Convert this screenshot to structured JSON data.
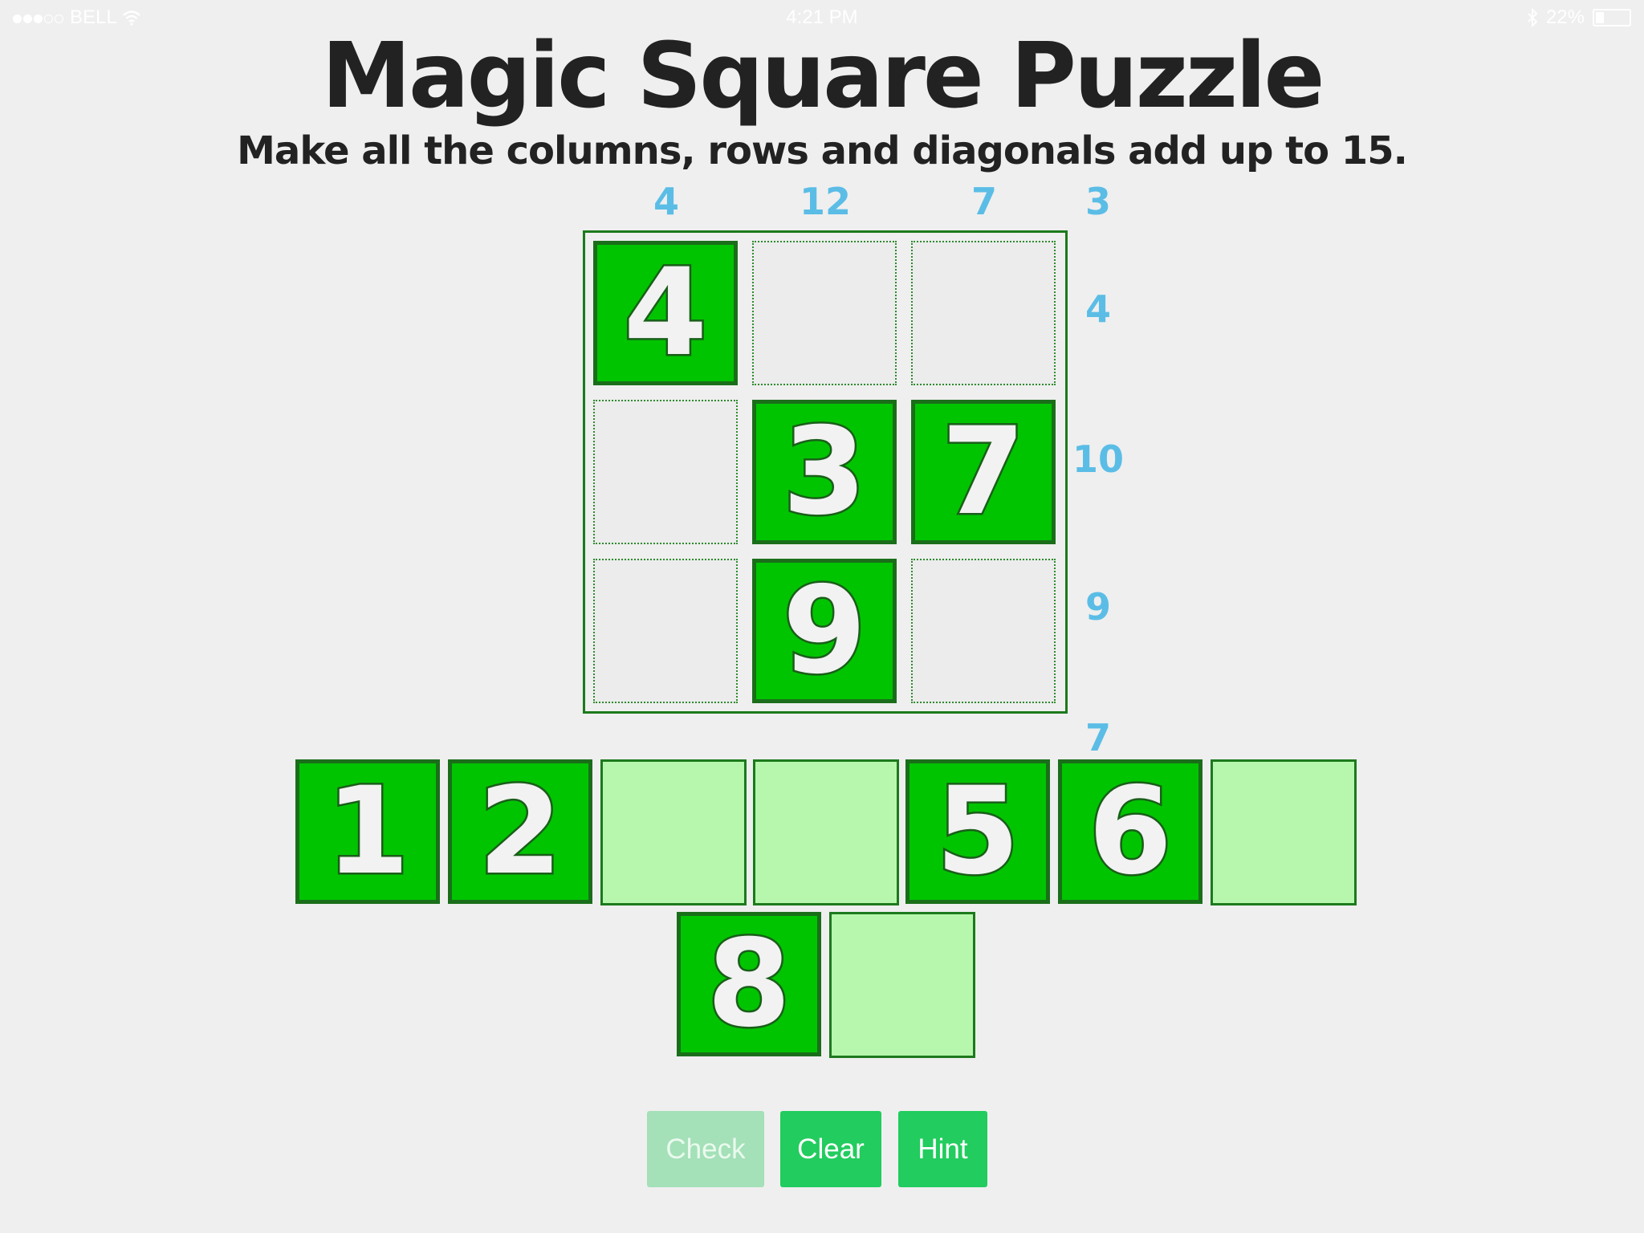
{
  "status_bar": {
    "carrier": "BELL",
    "time": "4:21 PM",
    "battery": "22%",
    "battery_level": 0.22
  },
  "title": "Magic Square Puzzle",
  "instructions": "Make all the columns, rows and diagonals add up to 15.",
  "target_sum": 15,
  "column_sums": [
    "4",
    "12",
    "7"
  ],
  "diagonal_sums": {
    "anti_diagonal": "3",
    "main_diagonal": "7"
  },
  "row_sums": [
    "4",
    "10",
    "9"
  ],
  "board": {
    "cells": [
      [
        "4",
        "",
        ""
      ],
      [
        "",
        "3",
        "7"
      ],
      [
        "",
        "9",
        ""
      ]
    ]
  },
  "tray": {
    "row1": [
      "1",
      "2",
      "",
      "",
      "5",
      "6",
      ""
    ],
    "row2": [
      "8",
      ""
    ]
  },
  "buttons": {
    "check": "Check",
    "clear": "Clear",
    "hint": "Hint"
  },
  "colors": {
    "tile": "#00c400",
    "tile_border": "#1a6e1a",
    "empty_slot": "#b7f7ad",
    "sum_text": "#5bbde6",
    "button": "#22cc5e",
    "button_disabled": "#a4e0b8"
  }
}
